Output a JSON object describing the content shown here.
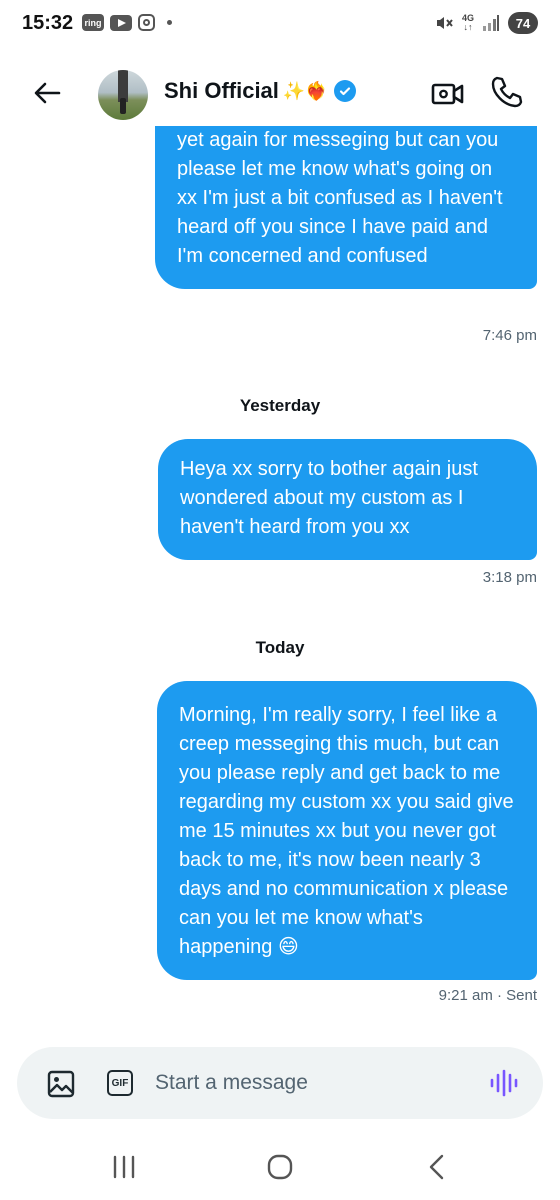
{
  "status_bar": {
    "time": "15:32",
    "ring_label": "ring",
    "network_label": "4G",
    "battery": "74"
  },
  "header": {
    "contact_name": "Shi Official",
    "name_emoji": "✨❤️‍🔥",
    "accent_color": "#1d9bf0"
  },
  "messages": [
    {
      "text": "yet again for messeging but can you please let me know what's going on xx I'm just a bit confused as I haven't heard off you since I have paid and I'm concerned and confused",
      "time": "7:46 pm"
    },
    {
      "separator": "Yesterday",
      "text": "Heya xx sorry to bother again just wondered about my custom as I haven't heard from you xx",
      "time": "3:18 pm"
    },
    {
      "separator": "Today",
      "text": "Morning, I'm really sorry, I feel like a creep messeging this much, but can you please reply and get back to me regarding my custom xx you said give me 15 minutes xx but you never got back to me, it's now been nearly 3 days and no communication x please can you let me know what's happening 😄",
      "time": "9:21 am · Sent"
    }
  ],
  "composer": {
    "placeholder": "Start a message",
    "gif_label": "GIF",
    "voice_color": "#7856ff"
  },
  "icons": [
    "back-arrow-icon",
    "video-call-icon",
    "phone-icon",
    "verified-icon",
    "image-icon",
    "gif-icon",
    "voice-icon",
    "recents-icon",
    "home-icon",
    "nav-back-icon"
  ]
}
